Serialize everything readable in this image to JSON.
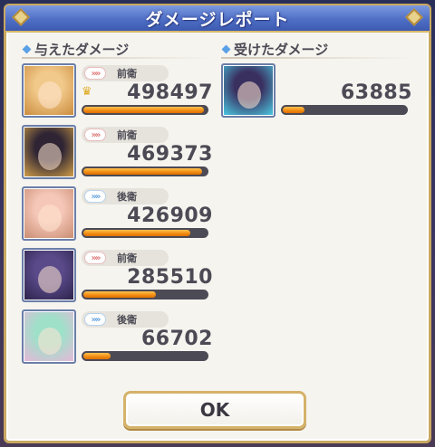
{
  "title": "ダメージレポート",
  "left_header": "与えたダメージ",
  "right_header": "受けたダメージ",
  "dealt": [
    {
      "position": "前衛",
      "position_type": "front",
      "damage": "498497",
      "top": true,
      "bar_fraction": 0.98,
      "portrait_colors": [
        "#f1c98a",
        "#c9893a"
      ]
    },
    {
      "position": "前衛",
      "position_type": "front",
      "damage": "469373",
      "top": false,
      "bar_fraction": 0.96,
      "portrait_colors": [
        "#2e2433",
        "#d8a44a"
      ]
    },
    {
      "position": "後衛",
      "position_type": "back",
      "damage": "426909",
      "top": false,
      "bar_fraction": 0.87,
      "portrait_colors": [
        "#f5c7b8",
        "#c78a6e"
      ]
    },
    {
      "position": "前衛",
      "position_type": "front",
      "damage": "285510",
      "top": false,
      "bar_fraction": 0.59,
      "portrait_colors": [
        "#5a4a8a",
        "#2a2248"
      ]
    },
    {
      "position": "後衛",
      "position_type": "back",
      "damage": "66702",
      "top": false,
      "bar_fraction": 0.22,
      "portrait_colors": [
        "#9fe0c9",
        "#e9b6d9"
      ]
    }
  ],
  "taken": [
    {
      "damage": "63885",
      "bar_fraction": 0.18,
      "portrait_colors": [
        "#3a3060",
        "#4bd0e8"
      ]
    }
  ],
  "ok_label": "OK",
  "colors": {
    "accent": "#5a74c8",
    "gold": "#d5b26a",
    "bar_fill": "#f08a12"
  }
}
